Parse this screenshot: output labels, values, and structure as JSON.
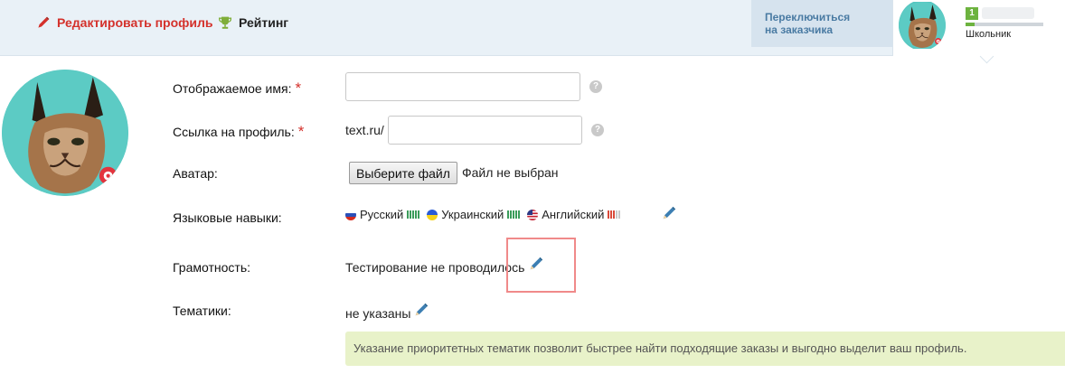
{
  "header": {
    "edit_profile": "Редактировать профиль",
    "rating": "Рейтинг",
    "switch_line1": "Переключиться",
    "switch_line2": "на заказчика",
    "user": {
      "level": "1",
      "rank": "Школьник",
      "progress_fraction": 0.12
    }
  },
  "form": {
    "display_name": {
      "label": "Отображаемое имя:",
      "required": "*",
      "value": "",
      "help": "?"
    },
    "profile_link": {
      "label": "Ссылка на профиль:",
      "required": "*",
      "prefix": "text.ru/",
      "value": "",
      "help": "?"
    },
    "avatar": {
      "label": "Аватар:",
      "button": "Выберите файл",
      "status": "Файл не выбран"
    },
    "languages": {
      "label": "Языковые навыки:",
      "items": [
        {
          "name": "Русский",
          "flag": "flag-ru-icon",
          "level": 5,
          "color": "#3a9c5a"
        },
        {
          "name": "Украинский",
          "flag": "flag-ua-icon",
          "level": 5,
          "color": "#3a9c5a"
        },
        {
          "name": "Английский",
          "flag": "flag-us-icon",
          "level": 3,
          "color": "#d94a3a"
        }
      ]
    },
    "literacy": {
      "label": "Грамотность:",
      "value": "Тестирование не проводилось"
    },
    "topics": {
      "label": "Тематики:",
      "value": "не указаны"
    },
    "hint": "Указание приоритетных тематик позволит быстрее найти подходящие заказы и выгодно выделит ваш профиль."
  },
  "icons": {
    "edit": "pencil-icon",
    "rating": "trophy-icon",
    "help": "question-icon"
  },
  "colors": {
    "accent_red": "#d4312b",
    "link_blue": "#4a7ba3",
    "pencil_blue": "#3d7fb3",
    "level_green": "#6db33f",
    "hint_bg": "#e8f2c9"
  }
}
